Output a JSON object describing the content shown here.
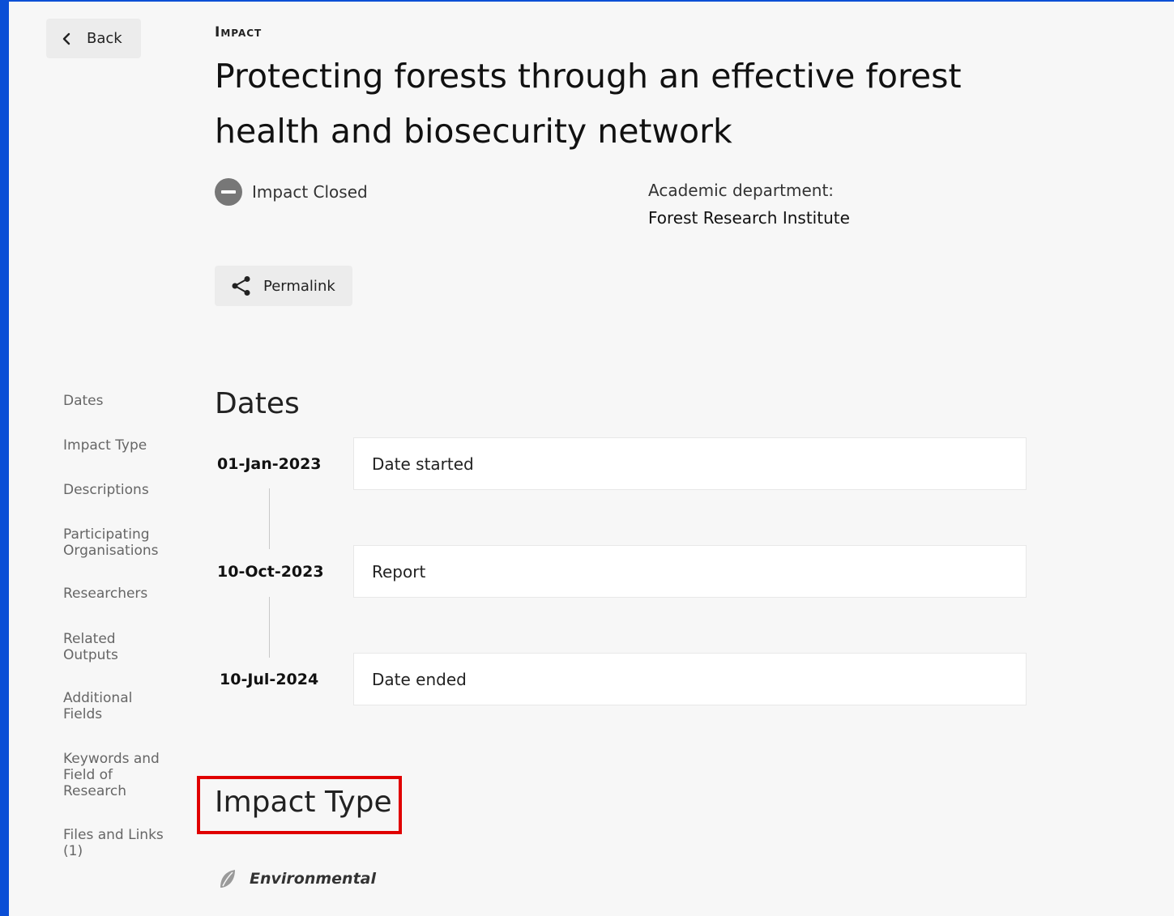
{
  "header": {
    "back_label": "Back",
    "kicker": "Impact",
    "title": "Protecting forests through an effective forest health and biosecurity network"
  },
  "status": {
    "label": "Impact Closed",
    "color": "#777777"
  },
  "department": {
    "label": "Academic department:",
    "value": "Forest Research Institute"
  },
  "permalink": {
    "label": "Permalink"
  },
  "side_nav": {
    "items": [
      {
        "label": "Dates"
      },
      {
        "label": "Impact Type"
      },
      {
        "label": "Descriptions"
      },
      {
        "label": "Participating Organisations"
      },
      {
        "label": "Researchers"
      },
      {
        "label": "Related Outputs"
      },
      {
        "label": "Additional Fields"
      },
      {
        "label": "Keywords and Field of Research"
      },
      {
        "label": "Files and Links (1)"
      }
    ]
  },
  "dates_section": {
    "title": "Dates",
    "entries": [
      {
        "date": "01-Jan-2023",
        "label": "Date started"
      },
      {
        "date": "10-Oct-2023",
        "label": "Report"
      },
      {
        "date": "10-Jul-2024",
        "label": "Date ended"
      }
    ]
  },
  "impact_type_section": {
    "title": "Impact Type",
    "items": [
      {
        "label": "Environmental",
        "icon": "leaf-icon"
      }
    ]
  },
  "colors": {
    "accent_blue": "#0b4fd6",
    "highlight_red": "#e00000"
  }
}
